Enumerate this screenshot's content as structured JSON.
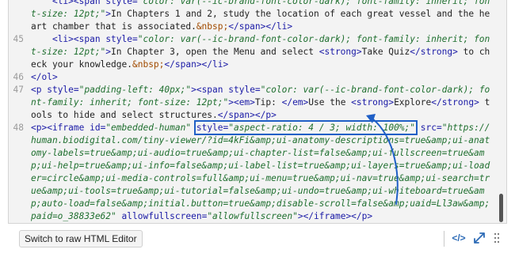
{
  "editor": {
    "lines": [
      {
        "n": "",
        "parts": [
          {
            "c": "x",
            "t": "    "
          },
          {
            "c": "t",
            "t": "<li><span "
          },
          {
            "c": "a",
            "t": "style="
          },
          {
            "c": "v",
            "t": "\"color: var(--ic-brand-font-color-dark); font-family: inherit; font-size: 12pt;\""
          },
          {
            "c": "t",
            "t": ">"
          },
          {
            "c": "x",
            "t": "In Chapters 1 and 2, study the location of each great vessel and the heart chamber that is associated."
          },
          {
            "c": "e",
            "t": "&nbsp;"
          },
          {
            "c": "t",
            "t": "</span></li>"
          }
        ]
      },
      {
        "n": "45",
        "parts": [
          {
            "c": "x",
            "t": "    "
          },
          {
            "c": "t",
            "t": "<li><span "
          },
          {
            "c": "a",
            "t": "style="
          },
          {
            "c": "v",
            "t": "\"color: var(--ic-brand-font-color-dark); font-family: inherit; font-size: 12pt;\""
          },
          {
            "c": "t",
            "t": ">"
          },
          {
            "c": "x",
            "t": "In Chapter 3, open the Menu and select "
          },
          {
            "c": "t",
            "t": "<strong>"
          },
          {
            "c": "x",
            "t": "Take Quiz"
          },
          {
            "c": "t",
            "t": "</strong>"
          },
          {
            "c": "x",
            "t": " to check your knowledge."
          },
          {
            "c": "e",
            "t": "&nbsp;"
          },
          {
            "c": "t",
            "t": "</span></li>"
          }
        ]
      },
      {
        "n": "46",
        "parts": [
          {
            "c": "t",
            "t": "</ol>"
          }
        ]
      },
      {
        "n": "47",
        "parts": [
          {
            "c": "t",
            "t": "<p "
          },
          {
            "c": "a",
            "t": "style="
          },
          {
            "c": "v",
            "t": "\"padding-left: 40px;\""
          },
          {
            "c": "t",
            "t": "><span "
          },
          {
            "c": "a",
            "t": "style="
          },
          {
            "c": "v",
            "t": "\"color: var(--ic-brand-font-color-dark); font-family: inherit; font-size: 12pt;\""
          },
          {
            "c": "t",
            "t": "><em>"
          },
          {
            "c": "x",
            "t": "Tip: "
          },
          {
            "c": "t",
            "t": "</em>"
          },
          {
            "c": "x",
            "t": "Use the "
          },
          {
            "c": "t",
            "t": "<strong>"
          },
          {
            "c": "x",
            "t": "Explore"
          },
          {
            "c": "t",
            "t": "</strong>"
          },
          {
            "c": "x",
            "t": " tools to hide and select structures."
          },
          {
            "c": "t",
            "t": "</span></p>"
          }
        ]
      },
      {
        "n": "48",
        "parts": [
          {
            "c": "t",
            "t": "<p><iframe "
          },
          {
            "c": "a",
            "t": "id="
          },
          {
            "c": "v",
            "t": "\"embedded-human\""
          },
          {
            "c": "x",
            "t": " "
          },
          {
            "c": "a",
            "t": "style=",
            "hl": true
          },
          {
            "c": "v",
            "t": "\"aspect-ratio: 4 / 3; width: 100%;\"",
            "hl": true
          },
          {
            "c": "x",
            "t": " "
          },
          {
            "c": "a",
            "t": "src="
          },
          {
            "c": "v",
            "t": "\"https://human.biodigital.com/tiny-viewer/?id=4kFi&amp;ui-anatomy-descriptions=true&amp;ui-anatomy-labels=true&amp;ui-audio=true&amp;ui-chapter-list=false&amp;ui-fullscreen=true&amp;ui-help=true&amp;ui-info=false&amp;ui-label-list=true&amp;ui-layers=true&amp;ui-loader=circle&amp;ui-media-controls=full&amp;ui-menu=true&amp;ui-nav=true&amp;ui-search=true&amp;ui-tools=true&amp;ui-tutorial=false&amp;ui-undo=true&amp;ui-whiteboard=true&amp;auto-load=false&amp;initial.button=true&amp;disable-scroll=false&amp;uaid=Ll3aw&amp;paid=o_38833e62\""
          },
          {
            "c": "x",
            "t": " "
          },
          {
            "c": "a",
            "t": "allowfullscreen="
          },
          {
            "c": "v",
            "t": "\"allowfullscreen\""
          },
          {
            "c": "t",
            "t": "></iframe></p>"
          }
        ]
      },
      {
        "n": "49",
        "parts": [
          {
            "c": "t",
            "t": "<p>"
          },
          {
            "c": "e",
            "t": "&nbsp;"
          },
          {
            "c": "t",
            "t": "</p>"
          }
        ]
      }
    ]
  },
  "footer": {
    "raw_button_label": "Switch to raw HTML Editor",
    "code_icon_glyph": "</>",
    "expand_icon": "expand-icon",
    "grip_icon": "drag-grip-icon"
  },
  "colors": {
    "tag": "#1a1aa6",
    "attr_value": "#1f6f2f",
    "entity": "#a14b00",
    "highlight": "#1f5fc6",
    "accent_icon": "#2d6bb6"
  }
}
